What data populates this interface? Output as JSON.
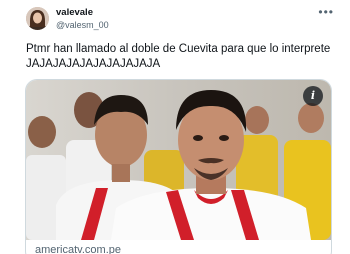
{
  "tweet": {
    "author": {
      "display_name": "valevale",
      "handle": "@valesm_00"
    },
    "more_icon": "more-horizontal-icon",
    "text": "Ptmr han llamado al doble de Cuevita para que lo interprete JAJAJAJAJAJAJAJAJAJA",
    "card": {
      "info_icon": "info-icon",
      "info_label": "i",
      "domain": "americatv.com.pe"
    }
  },
  "colors": {
    "text_primary": "#0f1419",
    "text_secondary": "#536471",
    "border": "#cfd9de",
    "jersey_red": "#d11f2a",
    "jersey_yellow": "#e9c31f"
  }
}
